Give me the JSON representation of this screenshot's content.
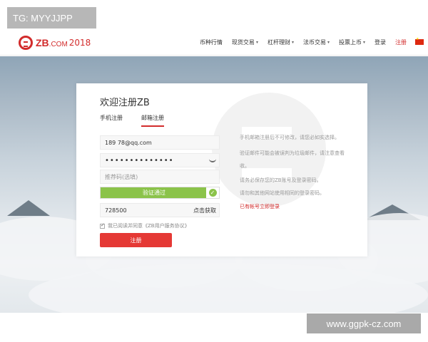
{
  "overlay": {
    "tg_tag": "TG: MYYJJPP",
    "site_tag": "www.ggpk-cz.com"
  },
  "header": {
    "logo_text": "ZB",
    "logo_suffix": ".COM",
    "logo_year": "2018",
    "nav": [
      {
        "label": "币种行情",
        "dropdown": false
      },
      {
        "label": "现货交易",
        "dropdown": true
      },
      {
        "label": "杠杆理财",
        "dropdown": true
      },
      {
        "label": "法币交易",
        "dropdown": true
      },
      {
        "label": "投票上币",
        "dropdown": true
      },
      {
        "label": "登录",
        "dropdown": false
      },
      {
        "label": "注册",
        "dropdown": false
      }
    ]
  },
  "form": {
    "title": "欢迎注册ZB",
    "tabs": [
      "手机注册",
      "邮箱注册"
    ],
    "active_tab": "邮箱注册",
    "email_value": "189          78@qq.com",
    "password_value": "••••••••••••••",
    "invite_placeholder": "推荐码(选填)",
    "verify_text": "验证通过",
    "code_value": "728500",
    "code_button": "点击获取",
    "agree_text": "我已阅读并同意《ZB用户服务协议》",
    "submit_label": "注册"
  },
  "notices": [
    "手机邮箱注册后不可修改，请您必如实选择。",
    "验证邮件可能会被误判为垃圾邮件，请注意查看",
    "收。",
    "请务必保存您的ZB账号及登录密码。",
    "请勿和其他网站使用相同的登录密码。"
  ],
  "login_link": "已有帐号立即登录",
  "colors": {
    "brand_red": "#d22c2c",
    "button_red": "#e53935",
    "verify_green": "#8bc34a"
  }
}
